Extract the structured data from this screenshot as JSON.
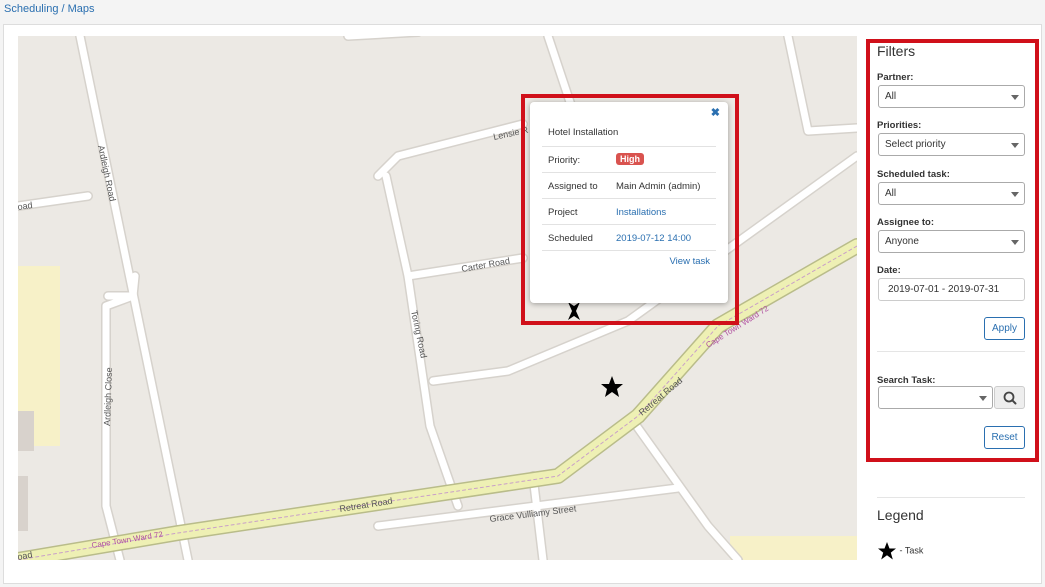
{
  "breadcrumb": "Scheduling / Maps",
  "map": {
    "roads": {
      "lensie": "Lensie R",
      "ardleigh_road": "Ardleigh Road",
      "carter": "Carter Road",
      "toring": "Toring Road",
      "ardleigh_close": "Ardleigh Close",
      "retreat_1": "Retreat Road",
      "retreat_2": "Retreat Road",
      "grace": "Grace Vulliamy Street",
      "oad": "oad",
      "oad2": "oad"
    },
    "ward_labels": [
      "Cape Town Ward 72",
      "Cape Town Ward 72"
    ]
  },
  "popup": {
    "close_icon": "close-icon",
    "title": "Hotel Installation",
    "rows": [
      {
        "label": "Priority:",
        "value": "High"
      },
      {
        "label": "Assigned to",
        "value": "Main Admin (admin)"
      },
      {
        "label": "Project",
        "value": "Installations"
      },
      {
        "label": "Scheduled",
        "value": "2019-07-12 14:00"
      }
    ],
    "view_task": "View task",
    "priority_color": "#d9534f"
  },
  "filters": {
    "title": "Filters",
    "partner": {
      "label": "Partner:",
      "value": "All"
    },
    "priorities": {
      "label": "Priorities:",
      "value": "Select priority"
    },
    "scheduled_task": {
      "label": "Scheduled task:",
      "value": "All"
    },
    "assignee": {
      "label": "Assignee to:",
      "value": "Anyone"
    },
    "date": {
      "label": "Date:",
      "value": "2019-07-01 - 2019-07-31"
    },
    "apply": "Apply",
    "search_task": {
      "label": "Search Task:",
      "value": ""
    },
    "reset": "Reset"
  },
  "legend": {
    "title": "Legend",
    "task_label": "- Task"
  },
  "colors": {
    "highlight": "#d0101a",
    "link": "#2a6fb0",
    "main_road_fill": "#eef0b4"
  }
}
